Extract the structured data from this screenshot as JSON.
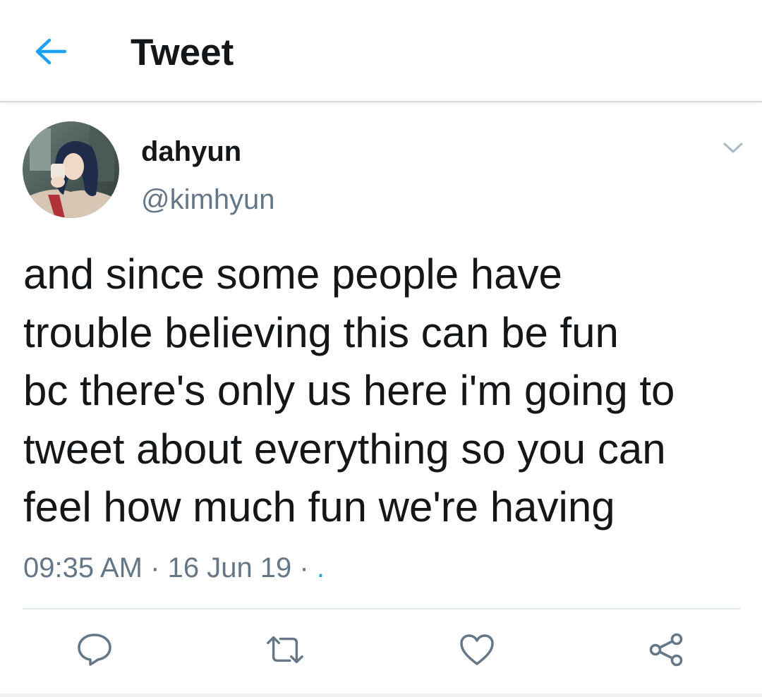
{
  "header": {
    "back_icon": "arrow-left-icon",
    "title": "Tweet",
    "accent_color": "#1da1f2"
  },
  "tweet": {
    "display_name": "dahyun",
    "handle": "@kimhyun",
    "text_lines": [
      "and since some people have",
      "trouble believing this can be fun",
      "bc there's only us here i'm going to",
      "tweet about everything so you can",
      "feel how much fun we're having"
    ],
    "time": "09:35 AM",
    "date": "16 Jun 19",
    "separator": "·",
    "trailing_link": "."
  },
  "actions": [
    {
      "icon": "reply-icon"
    },
    {
      "icon": "retweet-icon"
    },
    {
      "icon": "like-icon"
    },
    {
      "icon": "share-icon"
    }
  ],
  "colors": {
    "text_primary": "#14171a",
    "text_secondary": "#657786",
    "link": "#1da1f2",
    "icon_gray": "#657786"
  }
}
